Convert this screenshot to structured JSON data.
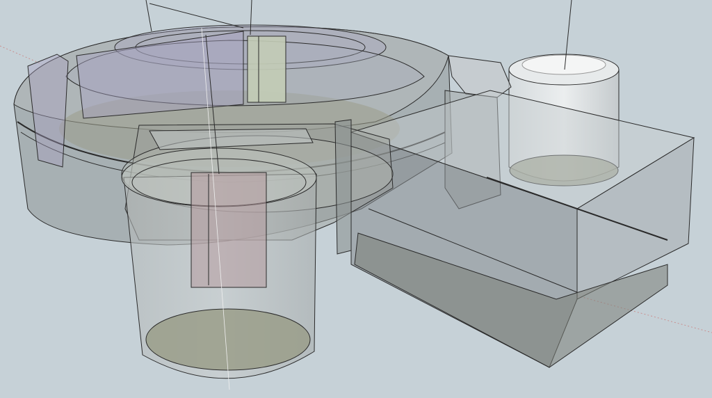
{
  "viewport": {
    "background_color": "#c6d1d7",
    "model_fill": "#8e9696",
    "floor_fill": "#9a9d8a",
    "edge_color": "#2a2a2a",
    "axis_color": "#c99090",
    "accent_purple": "#a7a2c0",
    "accent_pink": "#b59a9f",
    "accent_green": "#c3ccb6"
  }
}
